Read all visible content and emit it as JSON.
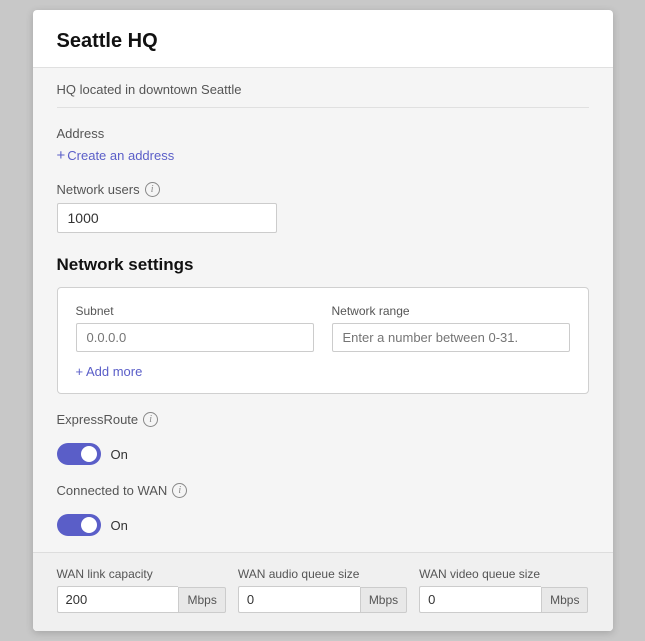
{
  "card": {
    "title": "Seattle HQ",
    "subtitle": "HQ located in downtown Seattle"
  },
  "address": {
    "label": "Address",
    "create_link": "Create an address"
  },
  "network_users": {
    "label": "Network users",
    "value": "1000"
  },
  "network_settings": {
    "heading": "Network settings",
    "subnet": {
      "label": "Subnet",
      "placeholder": "0.0.0.0"
    },
    "network_range": {
      "label": "Network range",
      "placeholder": "Enter a number between 0-31."
    },
    "add_more": "+ Add more"
  },
  "expressroute": {
    "label": "ExpressRoute",
    "status": "On"
  },
  "connected_to_wan": {
    "label": "Connected to WAN",
    "status": "On"
  },
  "wan": {
    "link_capacity": {
      "label": "WAN link capacity",
      "value": "200",
      "unit": "Mbps"
    },
    "audio_queue": {
      "label": "WAN audio queue size",
      "value": "0",
      "unit": "Mbps"
    },
    "video_queue": {
      "label": "WAN video queue size",
      "value": "0",
      "unit": "Mbps"
    }
  },
  "icons": {
    "help": "?",
    "plus": "+"
  }
}
